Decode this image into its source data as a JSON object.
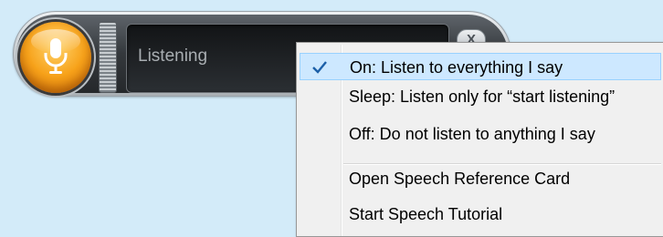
{
  "speech_bar": {
    "status_text": "Listening",
    "close_label": "X"
  },
  "context_menu": {
    "items": [
      {
        "label": "On: Listen to everything I say",
        "checked": true
      },
      {
        "label": "Sleep: Listen only for “start listening”",
        "checked": false
      },
      {
        "label": "Off: Do not listen to anything I say",
        "checked": false
      },
      {
        "label": "Open Speech Reference Card",
        "checked": false
      },
      {
        "label": "Start Speech Tutorial",
        "checked": false
      }
    ]
  },
  "colors": {
    "mic_orange": "#f7a21a",
    "menu_highlight": "#cde8ff",
    "check_blue": "#1c5fa8"
  },
  "icons": {
    "mic": "microphone-icon",
    "check": "checkmark-icon",
    "close": "close-icon"
  }
}
